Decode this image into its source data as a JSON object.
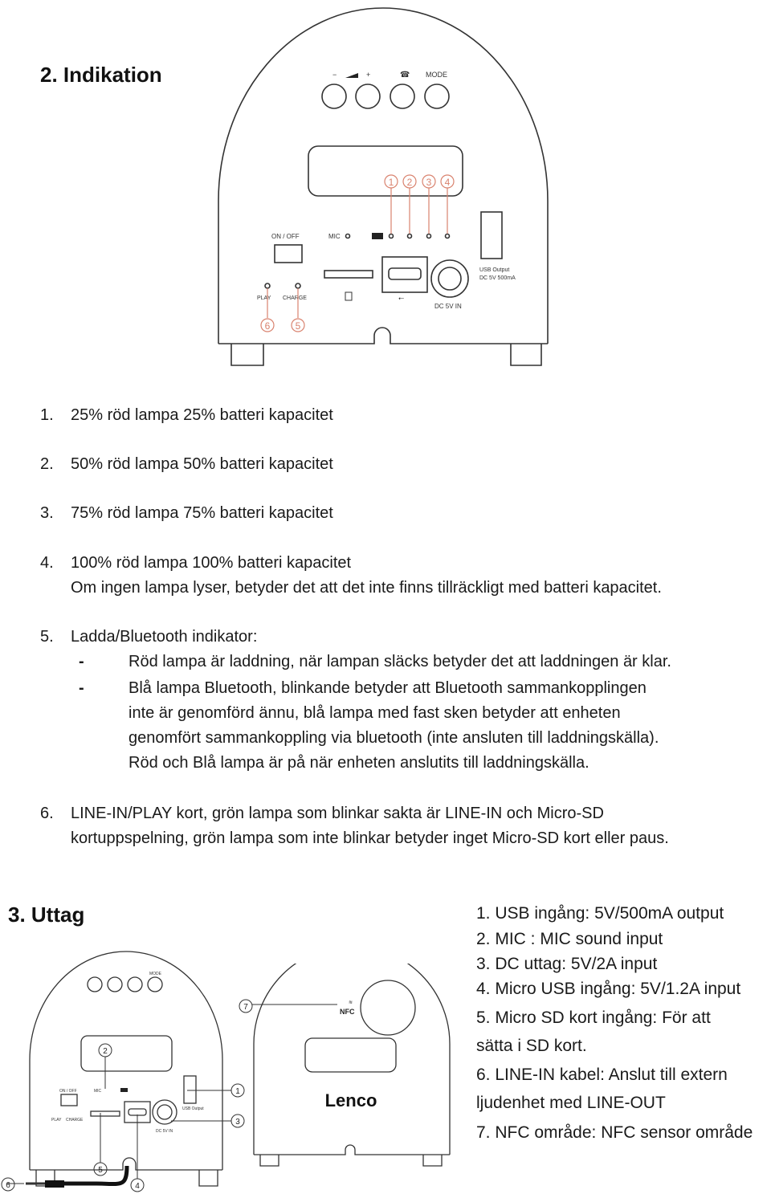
{
  "section2": {
    "title": "2. Indikation",
    "diagram": {
      "buttons": [
        "−",
        "+",
        "phone",
        "MODE"
      ],
      "labels": {
        "on_off": "ON / OFF",
        "mic": "MIC",
        "play": "PLAY",
        "charge": "CHARGE",
        "usb_output_line1": "USB Output",
        "usb_output_line2": "DC 5V 500mA",
        "dc_in": "DC 5V IN"
      },
      "callouts": [
        "1",
        "2",
        "3",
        "4",
        "5",
        "6"
      ],
      "callout_color": "#d9826e"
    },
    "items": [
      {
        "num": "1.",
        "text": "25% röd lampa 25% batteri kapacitet"
      },
      {
        "num": "2.",
        "text": "50% röd lampa 50% batteri kapacitet"
      },
      {
        "num": "3.",
        "text": "75% röd lampa 75% batteri kapacitet"
      },
      {
        "num": "4.",
        "text": "100% röd lampa 100% batteri kapacitet",
        "extra": "Om ingen lampa lyser, betyder det att det inte finns tillräckligt med batteri kapacitet."
      },
      {
        "num": "5.",
        "text": "Ladda/Bluetooth indikator:",
        "bullets": [
          {
            "marker": "-",
            "lines": [
              "Röd lampa är laddning, när lampan släcks betyder det att laddningen är klar."
            ]
          },
          {
            "marker": "-",
            "lines": [
              "Blå lampa Bluetooth, blinkande betyder att Bluetooth sammankopplingen",
              "inte är genomförd ännu, blå lampa med fast sken betyder att enheten",
              "genomfört sammankoppling via bluetooth (inte ansluten till laddningskälla).",
              "Röd och Blå lampa är på när enheten anslutits till laddningskälla."
            ]
          }
        ]
      },
      {
        "num": "6.",
        "text": "LINE-IN/PLAY kort, grön lampa som blinkar sakta är LINE-IN och Micro-SD",
        "extra": "kortuppspelning, grön lampa som inte blinkar betyder inget Micro-SD kort eller paus."
      }
    ]
  },
  "section3": {
    "title": "3. Uttag",
    "list": [
      "1. USB ingång: 5V/500mA output",
      "2. MIC : MIC sound input",
      "3. DC uttag: 5V/2A input",
      "4. Micro USB ingång: 5V/1.2A input",
      "5. Micro SD kort ingång: För att",
      "sätta i SD kort.",
      "6. LINE-IN kabel: Anslut till extern",
      "ljudenhet med LINE-OUT",
      "7. NFC område: NFC sensor område"
    ],
    "diagram_back": {
      "buttons": [
        "−",
        "+",
        "phone",
        "MODE"
      ],
      "labels": {
        "on_off": "ON / OFF",
        "mic": "MIC",
        "play": "PLAY",
        "charge": "CHARGE",
        "usb_output": "USB Output",
        "dc_in": "DC 5V IN"
      },
      "callouts": [
        "1",
        "2",
        "3",
        "4",
        "5",
        "6"
      ]
    },
    "diagram_front": {
      "brand": "Lenco",
      "nfc_label": "NFC",
      "callout": "7"
    }
  }
}
